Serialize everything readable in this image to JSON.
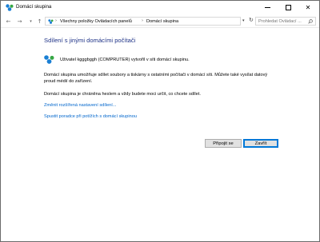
{
  "window": {
    "title": "Domácí skupina",
    "icon": "homegroup-icon"
  },
  "nav": {
    "back_icon": "arrow-left-icon",
    "forward_icon": "arrow-right-icon",
    "history_icon": "chevron-down-icon",
    "up_icon": "arrow-up-icon",
    "breadcrumbs": [
      "Všechny položky Ovládacích panelů",
      "Domácí skupina"
    ],
    "search_placeholder": "Prohledat Ovládací ..."
  },
  "content": {
    "heading": "Sdílení s jinými domácími počítači",
    "user_line": "Uživatel kgggbggh (COMPRUTER) vytvořil v síti domácí skupinu.",
    "paragraph1": "Domácí skupina umožňuje sdílet soubory a tiskárny s ostatními počítači v domácí síti. Můžete také vysílat datový proud médií do zařízení.",
    "paragraph2": "Domácí skupina je chráněna heslem a vždy budete moci určit, co chcete sdílet.",
    "link_advanced": "Změnit rozšířená nastavení sdílení...",
    "link_troubleshoot": "Spustit poradce při potížích s domácí skupinou"
  },
  "buttons": {
    "join": "Připojit se",
    "close": "Zavřít"
  },
  "colors": {
    "heading": "#1e3287",
    "link": "#0066cc",
    "focus_border": "#0078d7"
  }
}
